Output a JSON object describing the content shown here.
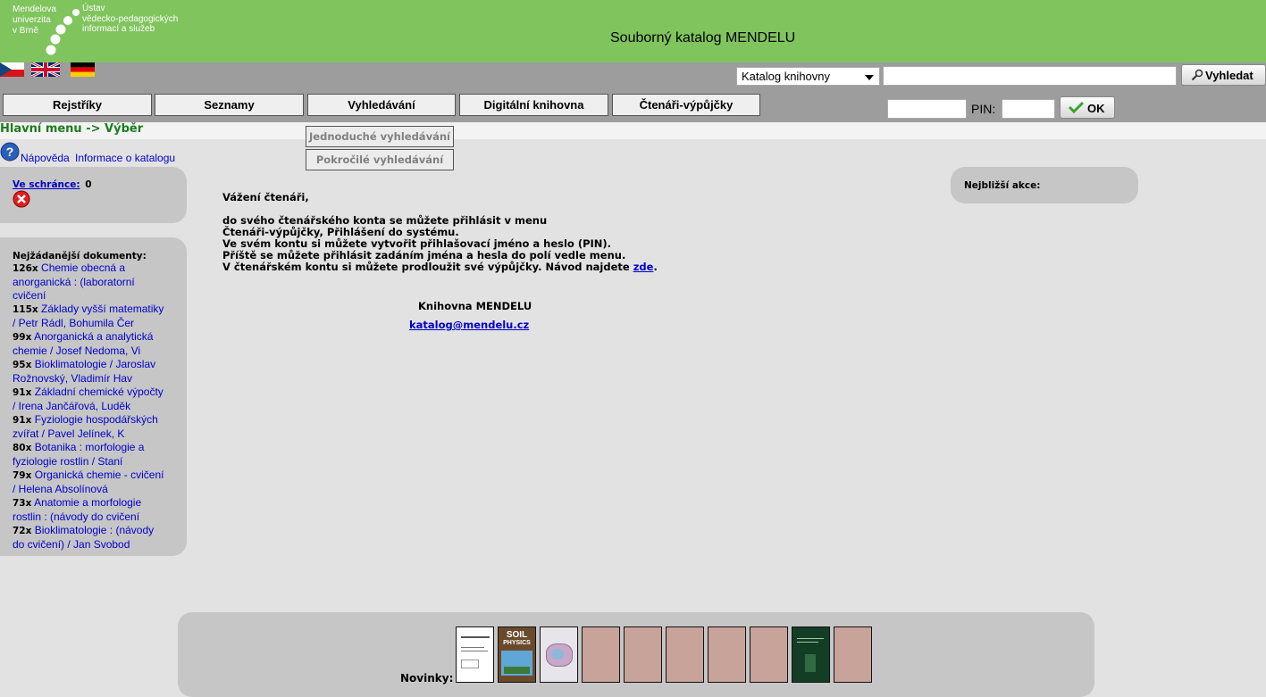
{
  "header": {
    "logo_left": [
      "Mendelova",
      "univerzita",
      "v Brně"
    ],
    "logo_right": [
      "Ústav",
      "vědecko-pedagogických",
      "informací a služeb"
    ],
    "title": "Souborný katalog MENDELU"
  },
  "flags": [
    "flag-czech-icon",
    "flag-uk-icon",
    "flag-germany-icon"
  ],
  "search": {
    "catalog_select": "Katalog knihovny",
    "query_value": "",
    "button_label": "Vyhledat"
  },
  "menu": {
    "items": [
      "Rejstříky",
      "Seznamy",
      "Vyhledávání",
      "Digitální knihovna",
      "Čtenáři-výpůjčky"
    ],
    "submenu": [
      "Jednoduché vyhledávání",
      "Pokročilé vyhledávání"
    ]
  },
  "login": {
    "pin_label": "PIN:",
    "ok_label": "OK"
  },
  "breadcrumb": "Hlavní menu -> Výběr",
  "help": {
    "napoveda": "Nápověda",
    "informace": "Informace o katalogu"
  },
  "clipboard": {
    "label": "Ve schránce:",
    "count": "0"
  },
  "top_docs": {
    "header": "Nejžádanější dokumenty:",
    "items": [
      {
        "count": "126x",
        "lines": [
          "Chemie obecná a",
          "anorganická : (laboratorní",
          "cvičení"
        ]
      },
      {
        "count": "115x",
        "lines": [
          "Základy vyšší matematiky",
          "/ Petr Rádl, Bohumila Čer"
        ]
      },
      {
        "count": "99x",
        "lines": [
          "Anorganická a analytická",
          "chemie / Josef Nedoma, Vi"
        ]
      },
      {
        "count": "95x",
        "lines": [
          "Bioklimatologie / Jaroslav",
          "Rožnovský, Vladimír Hav"
        ]
      },
      {
        "count": "91x",
        "lines": [
          "Základní chemické výpočty",
          "/ Irena Jančářová, Luděk"
        ]
      },
      {
        "count": "91x",
        "lines": [
          "Fyziologie hospodářských",
          "zvířat / Pavel Jelínek, K"
        ]
      },
      {
        "count": "80x",
        "lines": [
          "Botanika : morfologie a",
          "fyziologie rostlin / Staní"
        ]
      },
      {
        "count": "79x",
        "lines": [
          "Organická chemie - cvičení",
          "/ Helena Absolínová"
        ]
      },
      {
        "count": "73x",
        "lines": [
          "Anatomie a morfologie",
          "rostlin : (návody do cvičení"
        ]
      },
      {
        "count": "72x",
        "lines": [
          "Bioklimatologie : (návody",
          "do cvičení) / Jan Svobod"
        ]
      }
    ]
  },
  "events": {
    "label": "Nejbližší akce:"
  },
  "welcome": {
    "greeting": "Vážení čtenáři,",
    "line1": "do svého čtenářského konta se můžete přihlásit v menu",
    "line2": "Čtenáři-výpůjčky, Přihlášení do systému.",
    "line3": "Ve svém kontu si můžete vytvořit přihlašovací jméno a heslo (PIN).",
    "line4": "Příště se můžete přihlásit zadáním jména a hesla do polí vedle menu.",
    "line5_pre": "V čtenářském kontu si můžete prodloužit své výpůjčky. Návod najdete ",
    "line5_link": "zde",
    "line5_post": ".",
    "signature": "Knihovna MENDELU",
    "email": "katalog@mendelu.cz"
  },
  "news": {
    "label": "Novinky:",
    "covers": [
      "cover-white",
      "cover-soil-physics",
      "cover-map",
      "cover-blank",
      "cover-blank",
      "cover-blank",
      "cover-blank",
      "cover-blank",
      "cover-dark-green",
      "cover-blank"
    ],
    "soil_title": [
      "SOIL",
      "PHYSICS"
    ]
  },
  "colors": {
    "header_green": "#80c45d",
    "toolbar_grey": "#9d9d9d",
    "breadcrumb_green": "#1c7d1c",
    "link_blue": "#0000cc",
    "panel_grey": "#c6c6c6"
  }
}
